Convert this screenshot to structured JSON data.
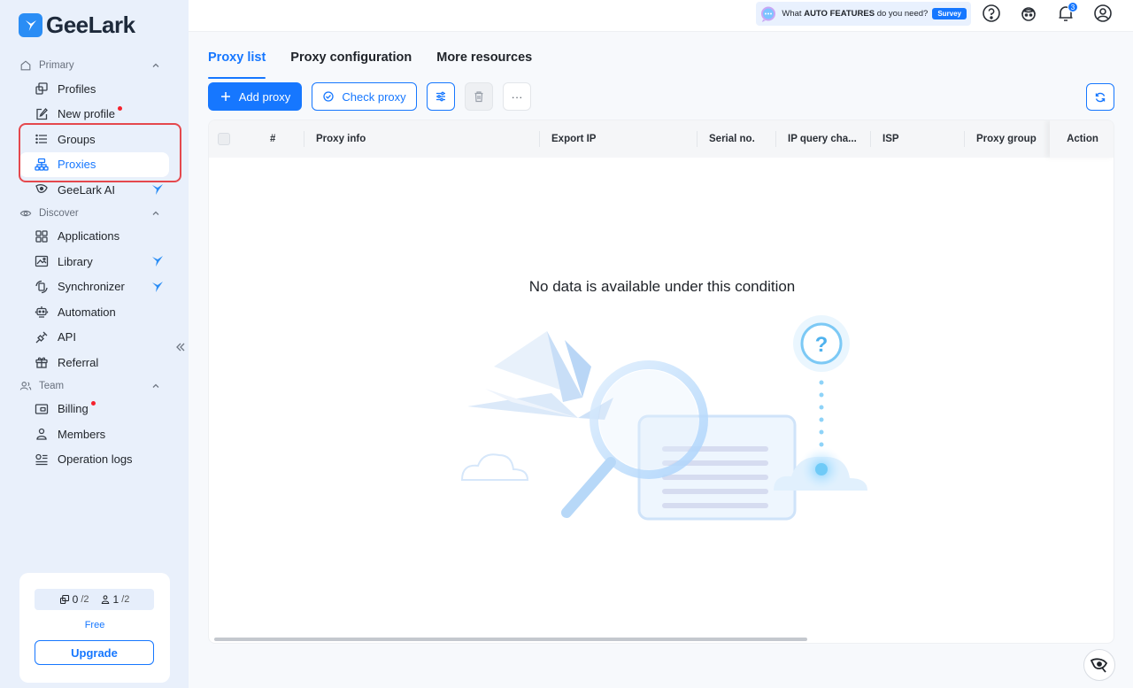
{
  "app": {
    "brand": "GeeLark"
  },
  "sidebar": {
    "sections": {
      "primary": "Primary",
      "discover": "Discover",
      "team": "Team"
    },
    "primary_items": [
      {
        "label": "Profiles",
        "icon": "profiles-icon"
      },
      {
        "label": "New profile",
        "icon": "edit-icon"
      },
      {
        "label": "Groups",
        "icon": "list-icon"
      },
      {
        "label": "Proxies",
        "icon": "proxies-icon"
      },
      {
        "label": "GeeLark AI",
        "icon": "ai-icon"
      }
    ],
    "discover_items": [
      {
        "label": "Applications",
        "icon": "grid-icon"
      },
      {
        "label": "Library",
        "icon": "library-icon"
      },
      {
        "label": "Synchronizer",
        "icon": "sync-icon"
      },
      {
        "label": "Automation",
        "icon": "robot-icon"
      },
      {
        "label": "API",
        "icon": "api-icon"
      },
      {
        "label": "Referral",
        "icon": "gift-icon"
      }
    ],
    "team_items": [
      {
        "label": "Billing",
        "icon": "billing-icon"
      },
      {
        "label": "Members",
        "icon": "person-icon"
      },
      {
        "label": "Operation logs",
        "icon": "logs-icon"
      }
    ],
    "plan": {
      "profiles_used": "0",
      "profiles_total": "/2",
      "members_used": "1",
      "members_total": "/2",
      "name": "Free",
      "upgrade_label": "Upgrade"
    }
  },
  "header": {
    "survey_prefix": "What ",
    "survey_bold": "AUTO FEATURES",
    "survey_suffix": " do you need?",
    "survey_button": "Survey",
    "notification_count": "3"
  },
  "main": {
    "tabs": [
      "Proxy list",
      "Proxy configuration",
      "More resources"
    ],
    "toolbar": {
      "add_proxy": "Add proxy",
      "check_proxy": "Check proxy",
      "more": "···"
    },
    "table": {
      "columns": [
        "#",
        "Proxy info",
        "Export IP",
        "Serial no.",
        "IP query cha...",
        "ISP",
        "Proxy group",
        "Action"
      ],
      "empty_message": "No data is available under this condition"
    }
  },
  "colors": {
    "accent": "#1677ff",
    "sidebar_bg": "#e9f0fb",
    "highlight": "#e5484d"
  }
}
